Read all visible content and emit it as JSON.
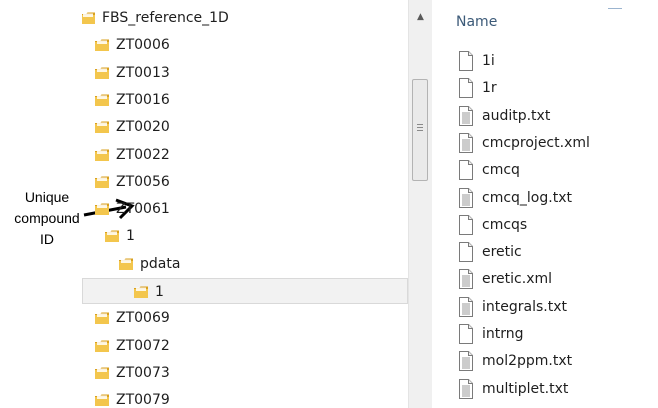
{
  "annotation": {
    "text": "Unique compound ID"
  },
  "tree": {
    "items": [
      {
        "label": "FBS_reference_1D",
        "level": 0,
        "selected": false
      },
      {
        "label": "ZT0006",
        "level": 1,
        "selected": false
      },
      {
        "label": "ZT0013",
        "level": 1,
        "selected": false
      },
      {
        "label": "ZT0016",
        "level": 1,
        "selected": false
      },
      {
        "label": "ZT0020",
        "level": 1,
        "selected": false
      },
      {
        "label": "ZT0022",
        "level": 1,
        "selected": false
      },
      {
        "label": "ZT0056",
        "level": 1,
        "selected": false
      },
      {
        "label": "ZT0061",
        "level": 1,
        "selected": false
      },
      {
        "label": "1",
        "level": 2,
        "selected": false
      },
      {
        "label": "pdata",
        "level": 3,
        "selected": false
      },
      {
        "label": "1",
        "level": 4,
        "selected": true
      },
      {
        "label": "ZT0069",
        "level": 1,
        "selected": false
      },
      {
        "label": "ZT0072",
        "level": 1,
        "selected": false
      },
      {
        "label": "ZT0073",
        "level": 1,
        "selected": false
      },
      {
        "label": "ZT0079",
        "level": 1,
        "selected": false
      }
    ]
  },
  "files": {
    "header": "Name",
    "items": [
      {
        "label": "1i",
        "type": "file"
      },
      {
        "label": "1r",
        "type": "file"
      },
      {
        "label": "auditp.txt",
        "type": "text"
      },
      {
        "label": "cmcproject.xml",
        "type": "text"
      },
      {
        "label": "cmcq",
        "type": "file"
      },
      {
        "label": "cmcq_log.txt",
        "type": "text"
      },
      {
        "label": "cmcqs",
        "type": "file"
      },
      {
        "label": "eretic",
        "type": "file"
      },
      {
        "label": "eretic.xml",
        "type": "text"
      },
      {
        "label": "integrals.txt",
        "type": "text"
      },
      {
        "label": "intrng",
        "type": "file"
      },
      {
        "label": "mol2ppm.txt",
        "type": "text"
      },
      {
        "label": "multiplet.txt",
        "type": "text"
      }
    ]
  },
  "icons": {
    "folder": "folder-icon",
    "file": "file-icon",
    "text_file": "text-file-icon",
    "scroll_up": "scroll-up-arrow-icon",
    "arrow": "annotation-arrow-icon"
  },
  "colors": {
    "folder_body": "#f3c64d",
    "folder_dark": "#d9a01e",
    "header_text": "#3c5a78",
    "selection_bg": "#f2f2f2"
  }
}
